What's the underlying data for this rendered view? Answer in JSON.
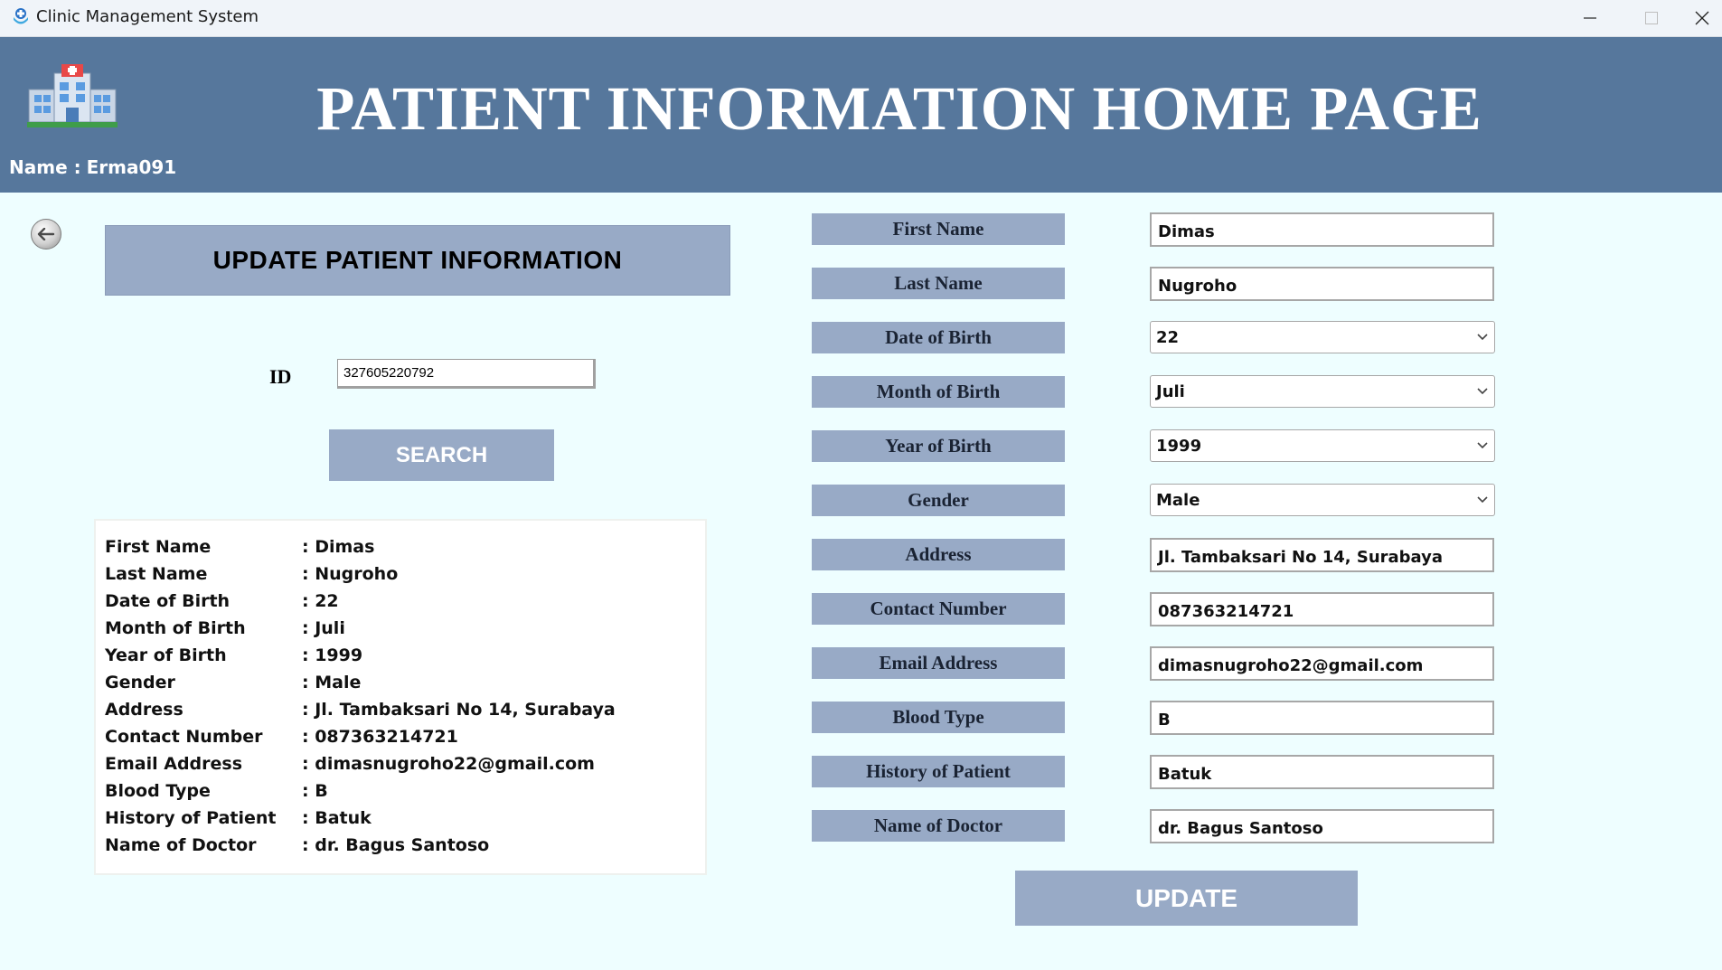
{
  "window": {
    "title": "Clinic Management System"
  },
  "header": {
    "heading": "PATIENT INFORMATION HOME PAGE",
    "user_label": "Name :",
    "user_name": "Erma091"
  },
  "left_panel": {
    "section_title": "UPDATE PATIENT  INFORMATION",
    "id_label": "ID",
    "id_value": "327605220792",
    "search_label": "SEARCH",
    "summary": [
      {
        "label": "First Name",
        "value": ": Dimas"
      },
      {
        "label": "Last Name",
        "value": ": Nugroho"
      },
      {
        "label": "Date of Birth",
        "value": ": 22"
      },
      {
        "label": "Month of Birth",
        "value": ": Juli"
      },
      {
        "label": "Year of Birth",
        "value": ": 1999"
      },
      {
        "label": "Gender",
        "value": ": Male"
      },
      {
        "label": "Address",
        "value": ": Jl. Tambaksari No 14, Surabaya"
      },
      {
        "label": "Contact Number",
        "value": ": 087363214721"
      },
      {
        "label": "Email Address",
        "value": ": dimasnugroho22@gmail.com"
      },
      {
        "label": "Blood Type",
        "value": ": B"
      },
      {
        "label": "History of Patient",
        "value": ": Batuk"
      },
      {
        "label": "Name of Doctor",
        "value": ": dr. Bagus Santoso"
      }
    ]
  },
  "form": {
    "fields": [
      {
        "label": "First Name",
        "value": "Dimas",
        "kind": "text"
      },
      {
        "label": "Last Name",
        "value": "Nugroho",
        "kind": "text"
      },
      {
        "label": "Date of Birth",
        "value": "22",
        "kind": "select"
      },
      {
        "label": "Month of Birth",
        "value": "Juli",
        "kind": "select"
      },
      {
        "label": "Year of Birth",
        "value": "1999",
        "kind": "select"
      },
      {
        "label": "Gender",
        "value": "Male",
        "kind": "select"
      },
      {
        "label": "Address",
        "value": "Jl. Tambaksari No 14, Surabaya",
        "kind": "text"
      },
      {
        "label": "Contact Number",
        "value": "087363214721",
        "kind": "text"
      },
      {
        "label": "Email Address",
        "value": "dimasnugroho22@gmail.com",
        "kind": "text"
      },
      {
        "label": "Blood Type",
        "value": "B",
        "kind": "text"
      },
      {
        "label": "History of Patient",
        "value": "Batuk",
        "kind": "text"
      },
      {
        "label": "Name of Doctor",
        "value": "dr. Bagus Santoso",
        "kind": "text"
      }
    ],
    "update_label": "UPDATE"
  },
  "colors": {
    "header_bg": "#56779c",
    "accent_button": "#98aac6",
    "page_bg": "#eefeff"
  },
  "icons": {
    "app": "clinic-app-icon",
    "logo": "hospital-building-icon",
    "back": "back-arrow-icon",
    "select": "chevron-down-icon"
  }
}
